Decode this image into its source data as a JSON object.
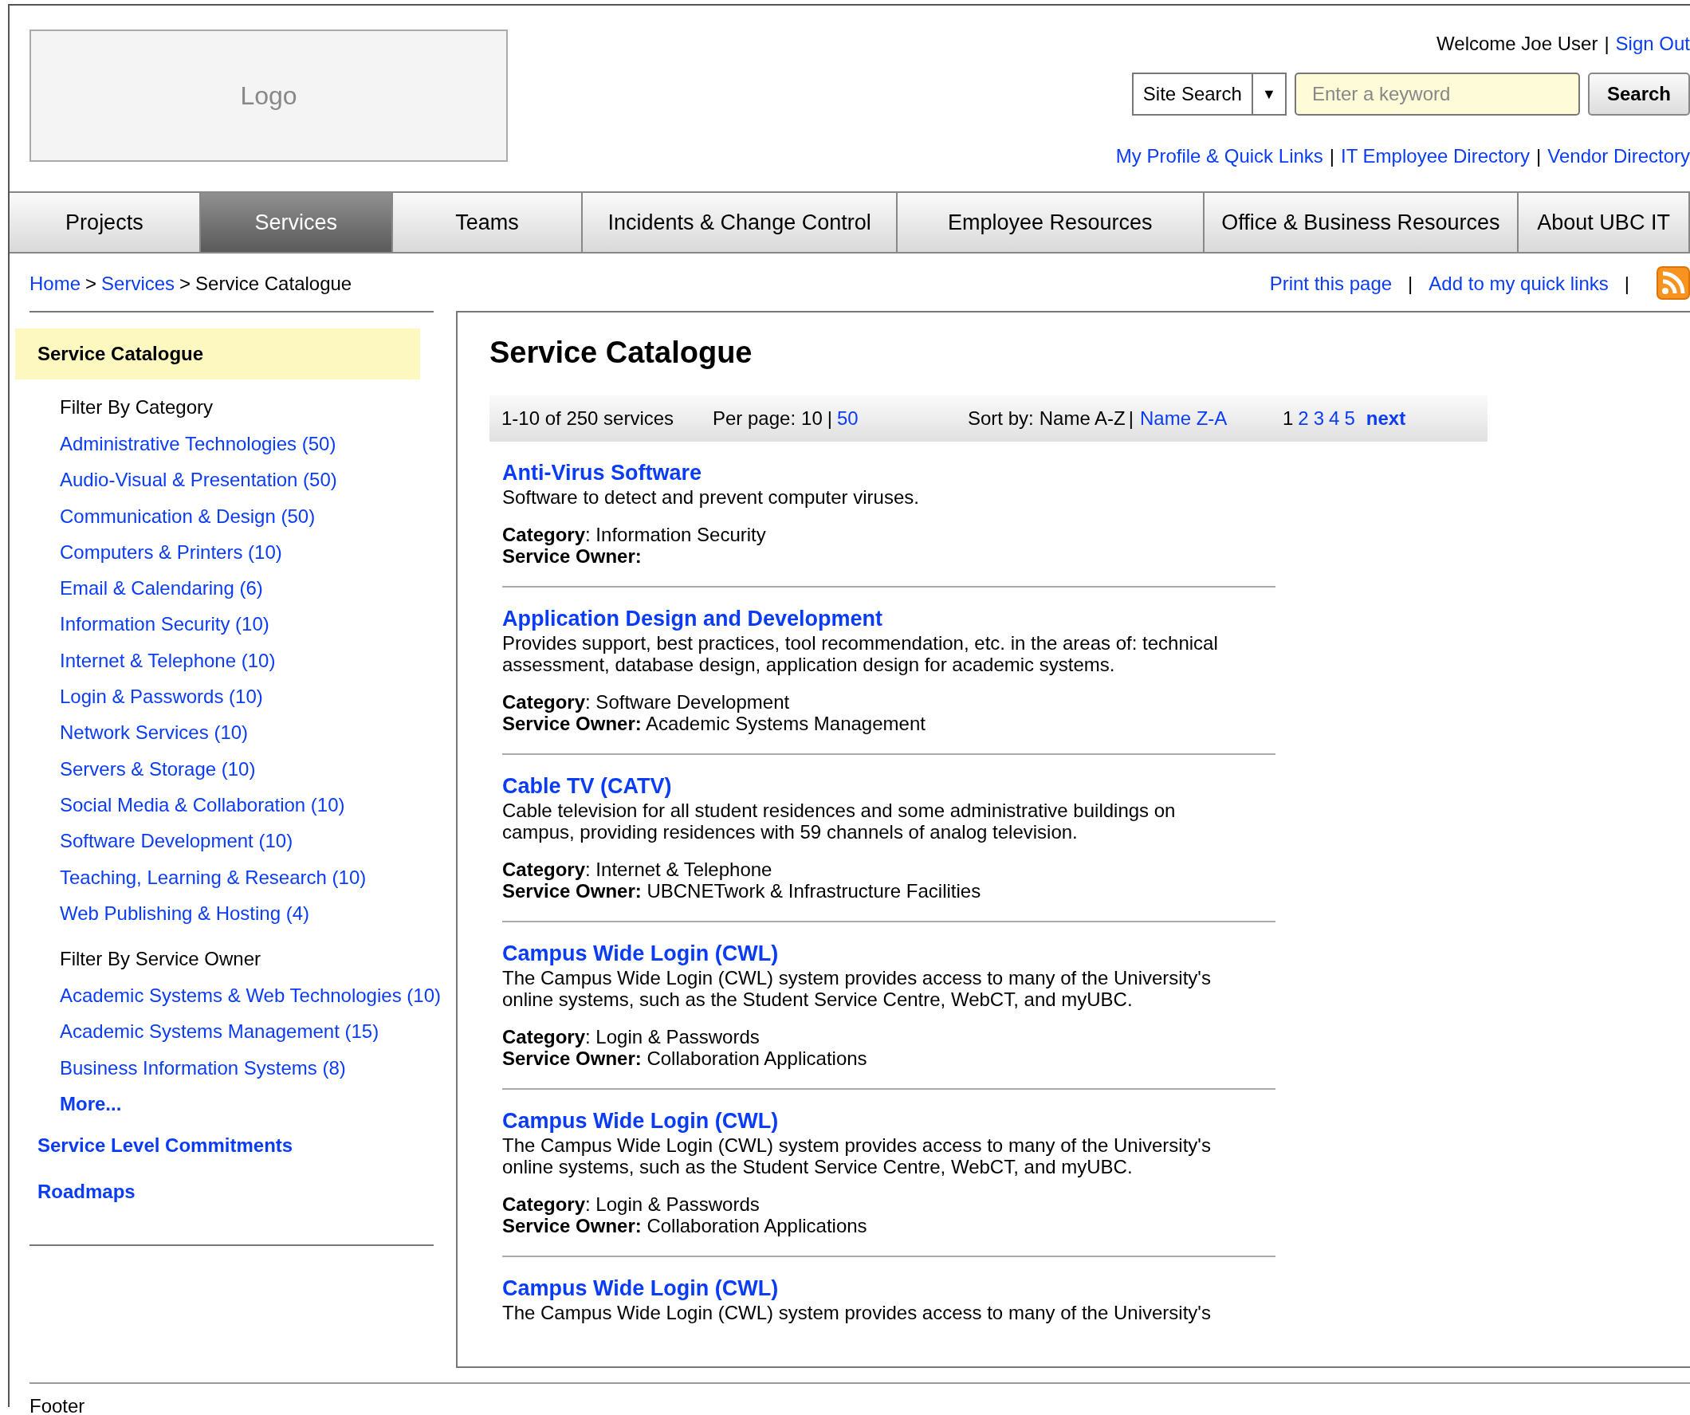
{
  "header": {
    "logo": "Logo",
    "welcome": "Welcome Joe User",
    "separator": "|",
    "sign_out": "Sign Out",
    "search_scope": "Site Search",
    "dropdown_caret": "▼",
    "search": {
      "placeholder": "Enter a keyword"
    },
    "search_button": "Search",
    "links": [
      "My Profile & Quick Links",
      "IT Employee Directory",
      "Vendor Directory"
    ]
  },
  "nav": [
    {
      "label": "Projects",
      "selected": false
    },
    {
      "label": "Services",
      "selected": true
    },
    {
      "label": "Teams",
      "selected": false
    },
    {
      "label": "Incidents & Change Control",
      "selected": false
    },
    {
      "label": "Employee Resources",
      "selected": false
    },
    {
      "label": "Office & Business Resources",
      "selected": false
    },
    {
      "label": "About UBC IT",
      "selected": false
    }
  ],
  "breadcrumb": {
    "separator": ">",
    "items": [
      {
        "label": "Home",
        "link": true
      },
      {
        "label": "Services",
        "link": true
      },
      {
        "label": "Service Catalogue",
        "link": false
      }
    ]
  },
  "page_actions": [
    "Print this page",
    "Add to my quick links"
  ],
  "sidebar": {
    "title": "Service Catalogue",
    "sections": [
      {
        "heading": "Filter By Category",
        "items": [
          "Administrative Technologies (50)",
          "Audio-Visual & Presentation (50)",
          "Communication & Design (50)",
          "Computers & Printers (10)",
          "Email & Calendaring (6)",
          "Information Security (10)",
          "Internet & Telephone (10)",
          "Login & Passwords (10)",
          "Network Services (10)",
          "Servers & Storage (10)",
          "Social Media & Collaboration (10)",
          "Software Development (10)",
          "Teaching, Learning & Research (10)",
          "Web Publishing & Hosting (4)"
        ]
      },
      {
        "heading": "Filter By Service Owner",
        "items": [
          "Academic Systems & Web Technologies (10)",
          "Academic Systems Management (15)",
          "Business Information Systems (8)"
        ],
        "more": "More..."
      }
    ],
    "links": [
      "Service Level Commitments",
      "Roadmaps"
    ]
  },
  "main": {
    "title": "Service Catalogue",
    "toolbar": {
      "count": "1-10 of 250 services",
      "per_page_label": "Per page:",
      "separator": "|",
      "per_page": [
        {
          "label": "10",
          "selected": true
        },
        {
          "label": "50",
          "selected": false
        }
      ],
      "sort_label": "Sort by:",
      "sort": [
        {
          "label": "Name A-Z",
          "selected": true
        },
        {
          "label": "Name Z-A",
          "selected": false
        }
      ],
      "pages": [
        {
          "label": "1",
          "selected": true
        },
        {
          "label": "2",
          "selected": false
        },
        {
          "label": "3",
          "selected": false
        },
        {
          "label": "4",
          "selected": false
        },
        {
          "label": "5",
          "selected": false
        }
      ],
      "next": "next"
    },
    "services": [
      {
        "name": "Anti-Virus Software",
        "description": "Software to detect and prevent computer viruses.",
        "category": "**Category**: Information Security",
        "owner": "**Service Owner:**"
      },
      {
        "name": "Application Design and Development",
        "description": "Provides support, best practices, tool recommendation, etc. in the areas of: technical assessment, database design, application design for academic systems.",
        "category": "**Category**: Software Development",
        "owner": "**Service Owner:** Academic Systems Management"
      },
      {
        "name": "Cable TV (CATV)",
        "description": "Cable television for all student residences and some administrative buildings on campus, providing residences with 59 channels of analog television.",
        "category": "**Category**: Internet & Telephone",
        "owner": "**Service Owner:** UBCNETwork & Infrastructure Facilities"
      },
      {
        "name": "Campus Wide Login (CWL)",
        "description": "The Campus Wide Login (CWL) system provides access to many of the University's online systems, such as the Student Service Centre, WebCT, and myUBC.",
        "category": "**Category**: Login & Passwords",
        "owner": "**Service Owner:** Collaboration Applications"
      },
      {
        "name": "Campus Wide Login (CWL)",
        "description": "The Campus Wide Login (CWL) system provides access to many of the University's online systems, such as the Student Service Centre, WebCT, and myUBC.",
        "category": "**Category**: Login & Passwords",
        "owner": "**Service Owner:** Collaboration Applications"
      },
      {
        "name": "Campus Wide Login (CWL)",
        "description": "The Campus Wide Login (CWL) system provides access to many of the University's"
      }
    ]
  },
  "footer": "Footer"
}
